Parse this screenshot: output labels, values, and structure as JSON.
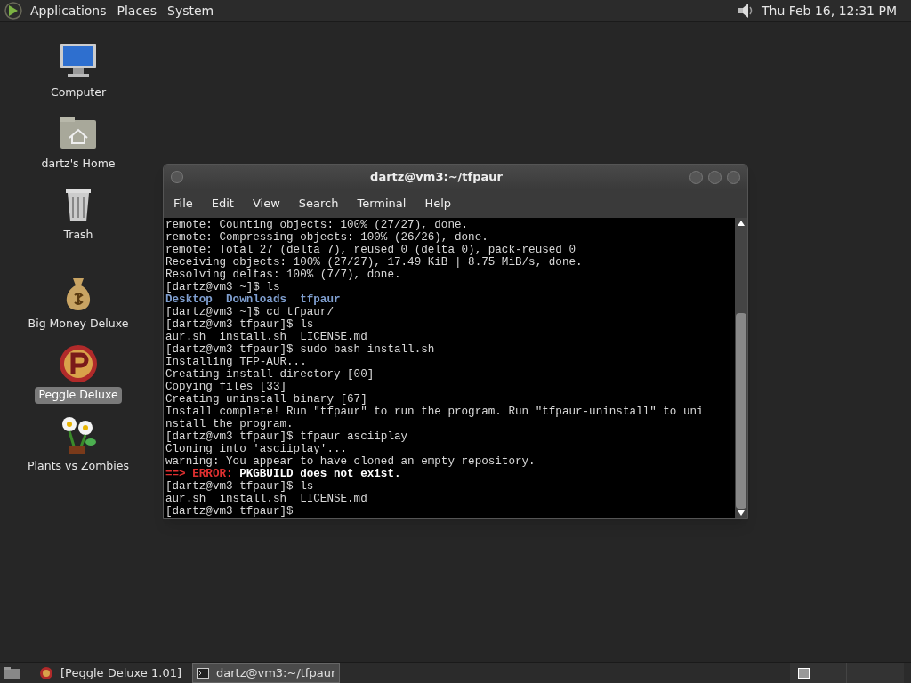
{
  "top_panel": {
    "menus": [
      "Applications",
      "Places",
      "System"
    ],
    "clock": "Thu Feb 16, 12:31 PM"
  },
  "desktop_icons": [
    {
      "kind": "computer",
      "label": "Computer",
      "selected": false
    },
    {
      "kind": "home",
      "label": "dartz's Home",
      "selected": false
    },
    {
      "kind": "trash",
      "label": "Trash",
      "selected": false
    },
    {
      "kind": "moneybag",
      "label": "Big Money Deluxe",
      "selected": false
    },
    {
      "kind": "ball",
      "label": "Peggle Deluxe",
      "selected": true
    },
    {
      "kind": "flower",
      "label": "Plants vs Zombies",
      "selected": false
    }
  ],
  "terminal": {
    "title": "dartz@vm3:~/tfpaur",
    "menu": [
      "File",
      "Edit",
      "View",
      "Search",
      "Terminal",
      "Help"
    ],
    "lines": [
      [
        {
          "kind": "plain",
          "text": "remote: Counting objects: 100% (27/27), done."
        }
      ],
      [
        {
          "kind": "plain",
          "text": "remote: Compressing objects: 100% (26/26), done."
        }
      ],
      [
        {
          "kind": "plain",
          "text": "remote: Total 27 (delta 7), reused 0 (delta 0), pack-reused 0"
        }
      ],
      [
        {
          "kind": "plain",
          "text": "Receiving objects: 100% (27/27), 17.49 KiB | 8.75 MiB/s, done."
        }
      ],
      [
        {
          "kind": "plain",
          "text": "Resolving deltas: 100% (7/7), done."
        }
      ],
      [
        {
          "kind": "plain",
          "text": "[dartz@vm3 ~]$ ls"
        }
      ],
      [
        {
          "kind": "dir",
          "text": "Desktop  Downloads  tfpaur"
        }
      ],
      [
        {
          "kind": "plain",
          "text": "[dartz@vm3 ~]$ cd tfpaur/"
        }
      ],
      [
        {
          "kind": "plain",
          "text": "[dartz@vm3 tfpaur]$ ls"
        }
      ],
      [
        {
          "kind": "plain",
          "text": "aur.sh  install.sh  LICENSE.md"
        }
      ],
      [
        {
          "kind": "plain",
          "text": "[dartz@vm3 tfpaur]$ sudo bash install.sh"
        }
      ],
      [
        {
          "kind": "plain",
          "text": "Installing TFP-AUR..."
        }
      ],
      [
        {
          "kind": "plain",
          "text": "Creating install directory [00]"
        }
      ],
      [
        {
          "kind": "plain",
          "text": "Copying files [33]"
        }
      ],
      [
        {
          "kind": "plain",
          "text": "Creating uninstall binary [67]"
        }
      ],
      [
        {
          "kind": "plain",
          "text": "Install complete! Run \"tfpaur\" to run the program. Run \"tfpaur-uninstall\" to uni"
        }
      ],
      [
        {
          "kind": "plain",
          "text": "nstall the program."
        }
      ],
      [
        {
          "kind": "plain",
          "text": "[dartz@vm3 tfpaur]$ tfpaur asciiplay"
        }
      ],
      [
        {
          "kind": "plain",
          "text": "Cloning into 'asciiplay'..."
        }
      ],
      [
        {
          "kind": "plain",
          "text": "warning: You appear to have cloned an empty repository."
        }
      ],
      [
        {
          "kind": "error",
          "text": "==> ERROR: "
        },
        {
          "kind": "bold",
          "text": "PKGBUILD does not exist."
        }
      ],
      [
        {
          "kind": "plain",
          "text": "[dartz@vm3 tfpaur]$ ls"
        }
      ],
      [
        {
          "kind": "plain",
          "text": "aur.sh  install.sh  LICENSE.md"
        }
      ],
      [
        {
          "kind": "plain",
          "text": "[dartz@vm3 tfpaur]$ "
        }
      ]
    ]
  },
  "taskbar": [
    {
      "kind": "game",
      "label": "[Peggle Deluxe 1.01]",
      "selected": false
    },
    {
      "kind": "terminal",
      "label": "dartz@vm3:~/tfpaur",
      "selected": true
    }
  ]
}
